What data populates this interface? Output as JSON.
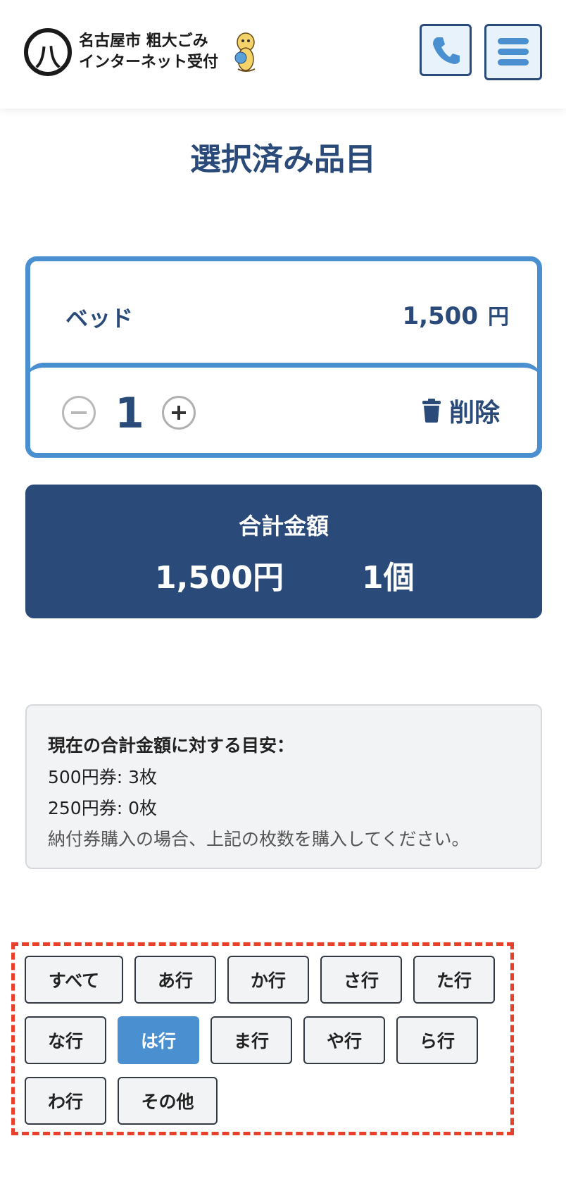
{
  "header": {
    "logo_line1": "名古屋市 粗大ごみ",
    "logo_line2": "インターネット受付",
    "logo_mark": "八"
  },
  "page": {
    "title": "選択済み品目"
  },
  "item": {
    "name": "ベッド",
    "price": "1,500",
    "price_unit": "円",
    "quantity": "1",
    "delete_label": "削除"
  },
  "total": {
    "label": "合計金額",
    "amount": "1,500円",
    "count": "1個"
  },
  "guide": {
    "title": "現在の合計金額に対する目安：",
    "ticket_500": "500円券: 3枚",
    "ticket_250": "250円券: 0枚",
    "note": "納付券購入の場合、上記の枚数を購入してください。"
  },
  "filters": {
    "selected": "は行",
    "tabs": [
      {
        "label": "すべて"
      },
      {
        "label": "あ行"
      },
      {
        "label": "か行"
      },
      {
        "label": "さ行"
      },
      {
        "label": "た行"
      },
      {
        "label": "な行"
      },
      {
        "label": "は行"
      },
      {
        "label": "ま行"
      },
      {
        "label": "や行"
      },
      {
        "label": "ら行"
      },
      {
        "label": "わ行"
      },
      {
        "label": "その他"
      }
    ]
  },
  "colors": {
    "primary": "#2a4a7a",
    "accent": "#4a8fd0",
    "highlight": "#e8402a"
  },
  "icons": {
    "phone": "phone-icon",
    "menu": "hamburger-menu-icon",
    "trash": "trash-icon",
    "minus": "minus-circle-icon",
    "plus": "plus-circle-icon"
  }
}
